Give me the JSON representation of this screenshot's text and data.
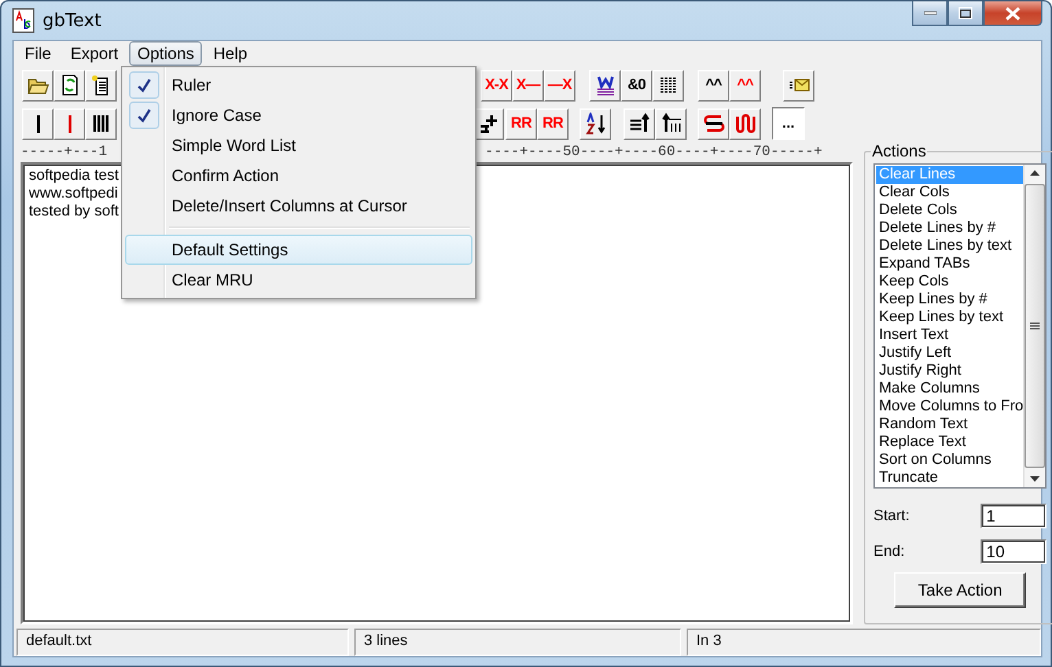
{
  "window": {
    "title": "gbText"
  },
  "menu": [
    {
      "label": "File",
      "selected": false
    },
    {
      "label": "Export",
      "selected": false
    },
    {
      "label": "Options",
      "selected": true
    },
    {
      "label": "Help",
      "selected": false
    }
  ],
  "options_menu": [
    {
      "kind": "item",
      "label": "Ruler",
      "checked": true,
      "highlighted": false
    },
    {
      "kind": "item",
      "label": "Ignore Case",
      "checked": true,
      "highlighted": false
    },
    {
      "kind": "item",
      "label": "Simple Word List",
      "checked": false,
      "highlighted": false
    },
    {
      "kind": "item",
      "label": "Confirm Action",
      "checked": false,
      "highlighted": false
    },
    {
      "kind": "item",
      "label": "Delete/Insert Columns at Cursor",
      "checked": false,
      "highlighted": false
    },
    {
      "kind": "separator"
    },
    {
      "kind": "item",
      "label": "Default Settings",
      "checked": false,
      "highlighted": true
    },
    {
      "kind": "item",
      "label": "Clear MRU",
      "checked": false,
      "highlighted": false
    }
  ],
  "toolbar_1": [
    [
      {
        "kind": "icon"
      },
      {
        "kind": "icon"
      },
      {
        "kind": "icon"
      }
    ],
    [
      {
        "kind": "text",
        "label": "X-X",
        "color": "#ff0000"
      },
      {
        "kind": "text",
        "label": "X—",
        "color": "#ff0000"
      },
      {
        "kind": "text",
        "label": "—X",
        "color": "#ff0000"
      }
    ],
    [
      {
        "kind": "icon"
      },
      {
        "kind": "text",
        "label": "&0",
        "color": "#000000"
      },
      {
        "kind": "icon"
      }
    ],
    [
      {
        "kind": "text",
        "label": "^^",
        "color": "#000000"
      },
      {
        "kind": "text",
        "label": "^^",
        "color": "#ff0000"
      }
    ],
    [
      {
        "kind": "icon"
      }
    ]
  ],
  "toolbar_2": [
    [
      {
        "kind": "icon"
      },
      {
        "kind": "icon"
      },
      {
        "kind": "icon"
      }
    ],
    [
      {
        "kind": "icon"
      }
    ],
    [
      {
        "kind": "text",
        "label": "RR",
        "color": "#ff0000"
      },
      {
        "kind": "text",
        "label": "RR",
        "color": "#ff0000"
      }
    ],
    [
      {
        "kind": "icon"
      }
    ],
    [
      {
        "kind": "icon"
      },
      {
        "kind": "icon"
      }
    ],
    [
      {
        "kind": "icon"
      },
      {
        "kind": "icon"
      }
    ],
    [
      {
        "kind": "sunken",
        "label": "..."
      }
    ]
  ],
  "ruler": {
    "left": "-----+---1",
    "right": "----+----50----+----60----+----70-----+"
  },
  "editor": {
    "lines": [
      "softpedia test",
      "www.softpedi",
      "tested by soft"
    ]
  },
  "actions": {
    "title": "Actions",
    "items": [
      {
        "label": "Clear Lines",
        "selected": true
      },
      {
        "label": "Clear Cols",
        "selected": false
      },
      {
        "label": "Delete Cols",
        "selected": false
      },
      {
        "label": "Delete Lines by #",
        "selected": false
      },
      {
        "label": "Delete Lines by text",
        "selected": false
      },
      {
        "label": "Expand TABs",
        "selected": false
      },
      {
        "label": "Keep Cols",
        "selected": false
      },
      {
        "label": "Keep Lines by #",
        "selected": false
      },
      {
        "label": "Keep Lines by text",
        "selected": false
      },
      {
        "label": "Insert Text",
        "selected": false
      },
      {
        "label": "Justify Left",
        "selected": false
      },
      {
        "label": "Justify Right",
        "selected": false
      },
      {
        "label": "Make Columns",
        "selected": false
      },
      {
        "label": "Move Columns to Fro",
        "selected": false
      },
      {
        "label": "Random Text",
        "selected": false
      },
      {
        "label": "Replace Text",
        "selected": false
      },
      {
        "label": "Sort on Columns",
        "selected": false
      },
      {
        "label": "Truncate",
        "selected": false
      }
    ],
    "start_label": "Start:",
    "start_value": "1",
    "end_label": "End:",
    "end_value": "10",
    "button": "Take Action"
  },
  "status_bar": [
    "default.txt",
    "3 lines",
    "In 3"
  ]
}
